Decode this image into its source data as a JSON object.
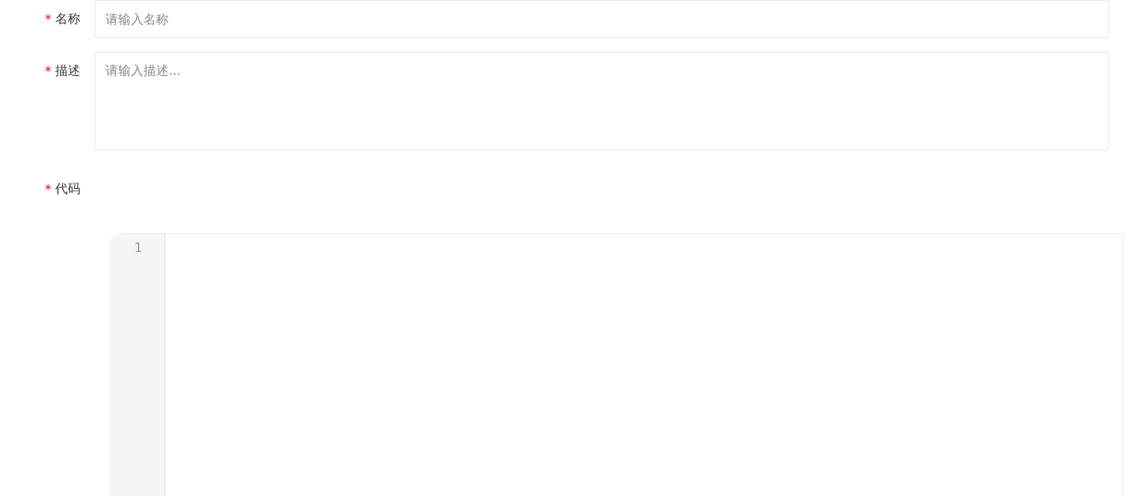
{
  "form": {
    "fields": [
      {
        "kind": "input",
        "mark": "*",
        "label": "名称",
        "placeholder": "请输入名称"
      },
      {
        "kind": "textarea",
        "mark": "*",
        "label": "描述",
        "placeholder": "请输入描述..."
      },
      {
        "kind": "code",
        "mark": "*",
        "label": "代码",
        "line_numbers": [
          "1"
        ]
      }
    ]
  }
}
